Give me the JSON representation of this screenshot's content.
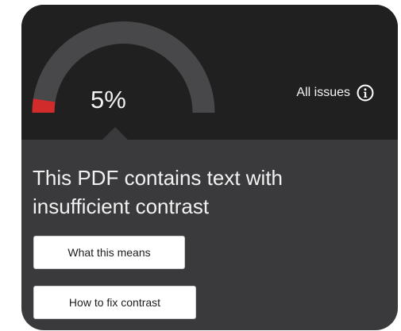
{
  "gauge": {
    "percent_label": "5%",
    "percent_value": 5,
    "track_color": "#48484a",
    "fill_color": "#d22b2b"
  },
  "header": {
    "all_issues_label": "All issues",
    "info_icon": "info-circle-icon"
  },
  "issue": {
    "title": "This PDF contains text with insufficient contrast"
  },
  "actions": {
    "what_this_means_label": "What this means",
    "how_to_fix_label": "How to fix contrast"
  },
  "colors": {
    "top_background": "#202021",
    "panel_background": "#3a3a3c",
    "button_background": "#ffffff"
  }
}
